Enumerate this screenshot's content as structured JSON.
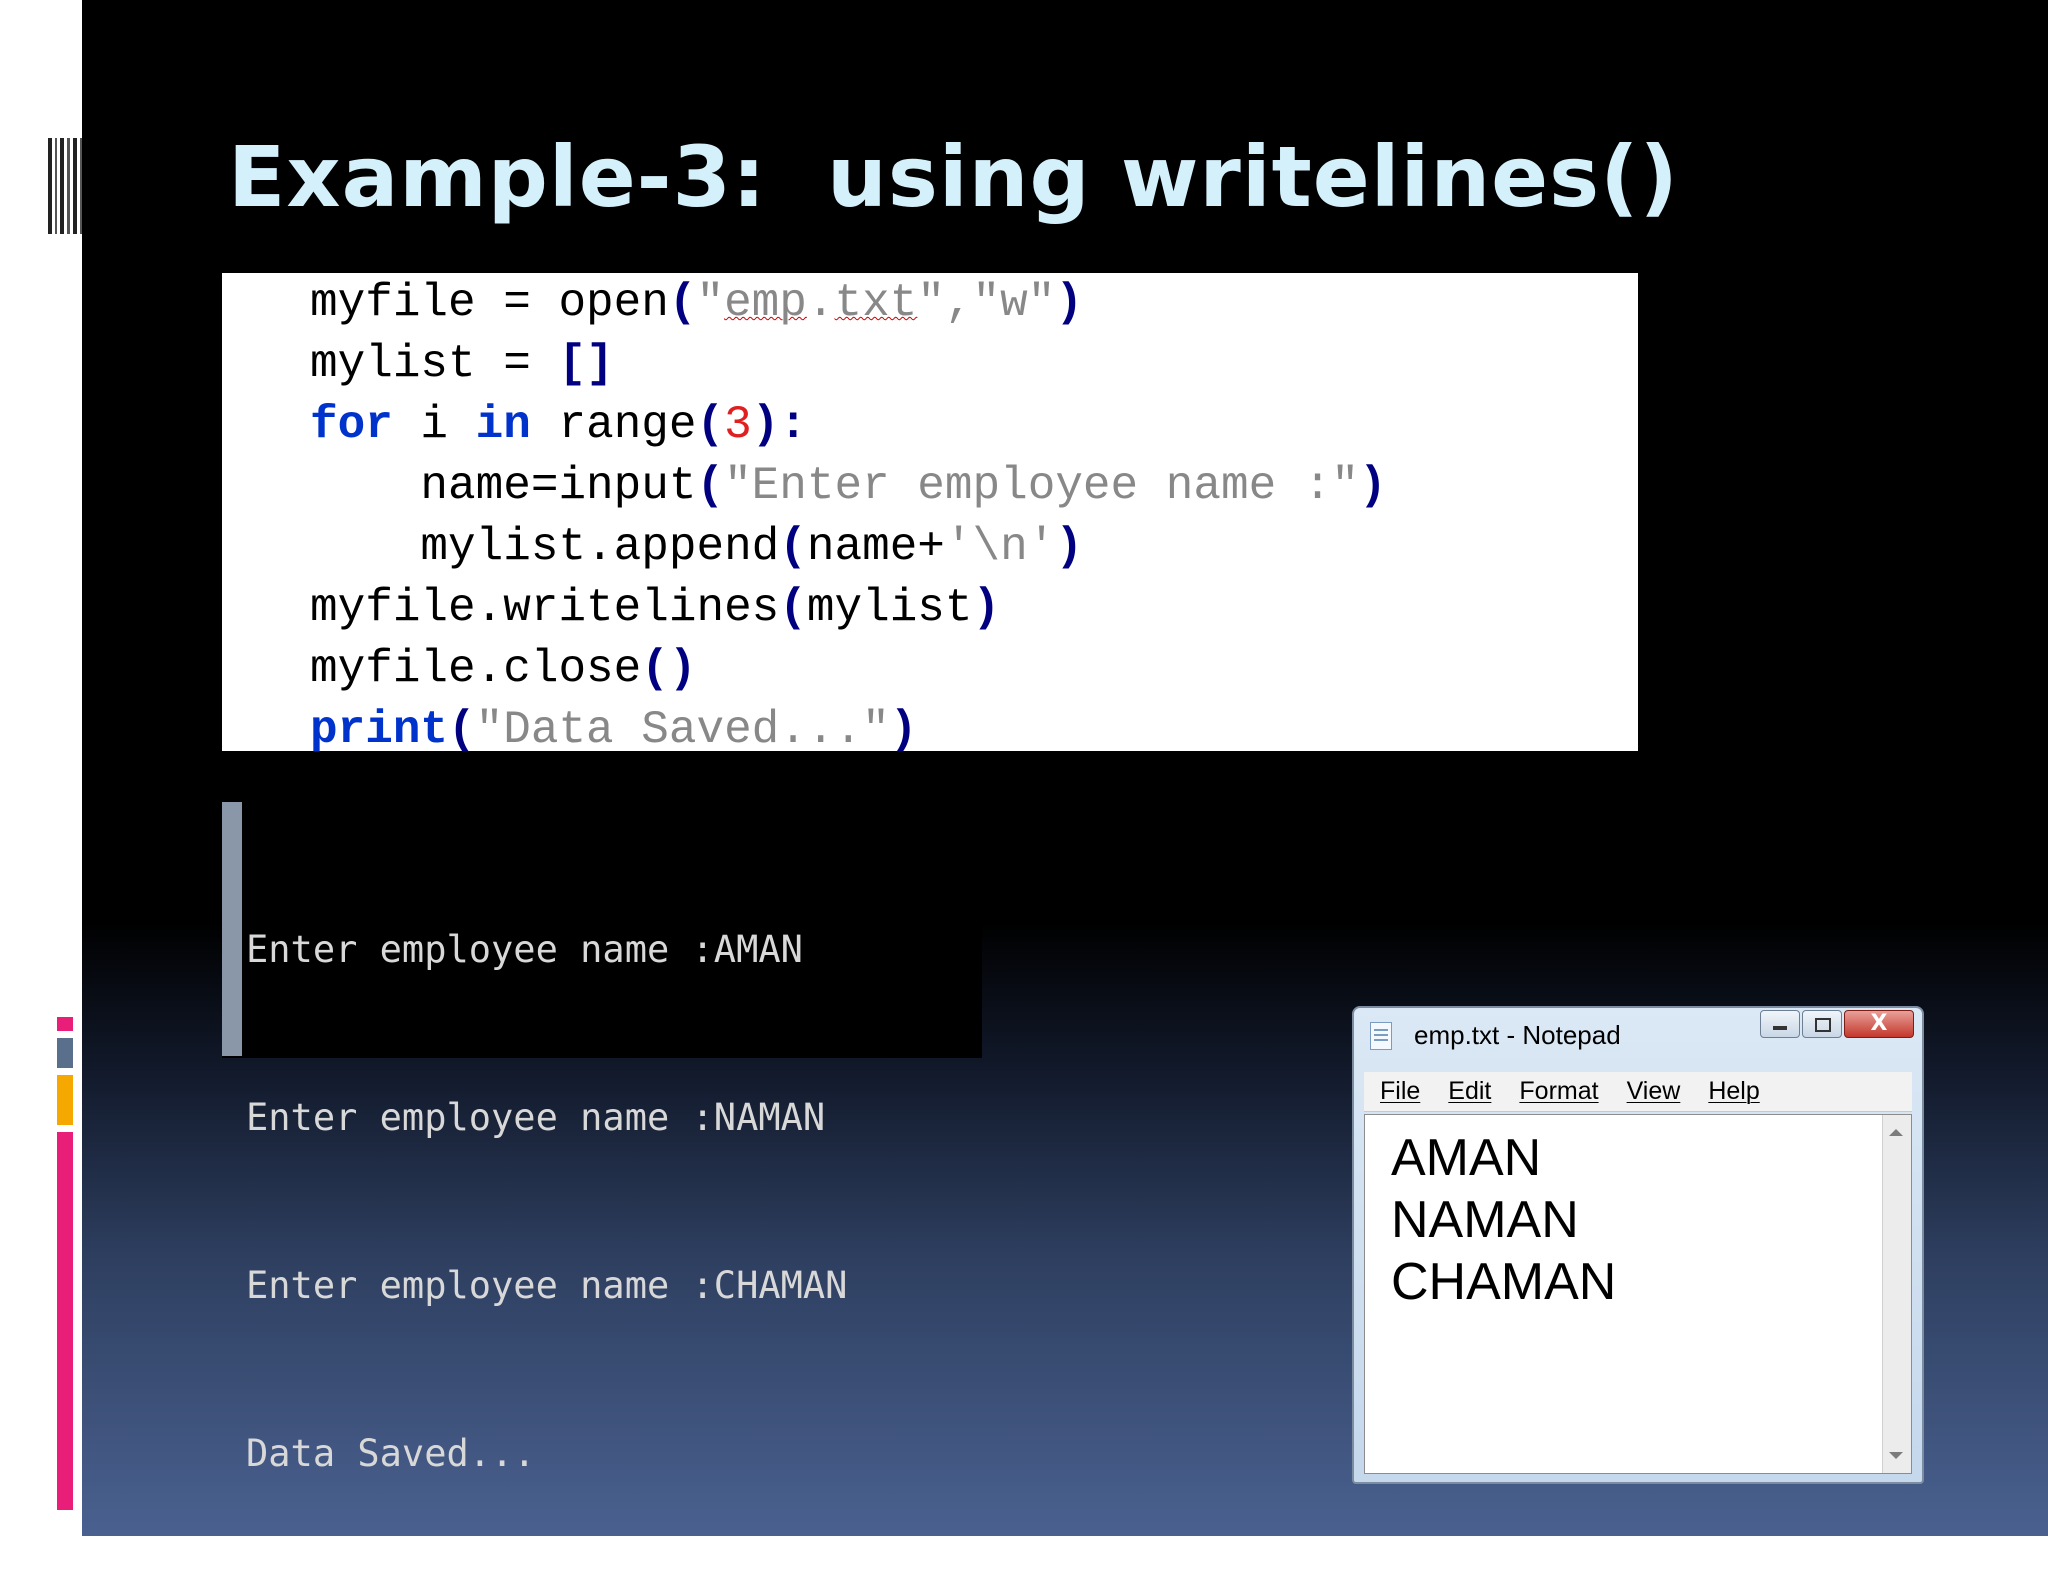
{
  "slide": {
    "title": "Example-3:  using writelines()"
  },
  "code": {
    "lines": [
      [
        {
          "t": "myfile = open",
          "c": ""
        },
        {
          "t": "(",
          "c": "par"
        },
        {
          "t": "\"",
          "c": "str"
        },
        {
          "t": "emp",
          "c": "str squig"
        },
        {
          "t": ".",
          "c": "str"
        },
        {
          "t": "txt",
          "c": "str squig"
        },
        {
          "t": "\",\"w\"",
          "c": "str"
        },
        {
          "t": ")",
          "c": "par"
        }
      ],
      [
        {
          "t": "mylist = ",
          "c": ""
        },
        {
          "t": "[]",
          "c": "par"
        }
      ],
      [
        {
          "t": "for",
          "c": "kw"
        },
        {
          "t": " i ",
          "c": ""
        },
        {
          "t": "in",
          "c": "kw"
        },
        {
          "t": " range",
          "c": ""
        },
        {
          "t": "(",
          "c": "par"
        },
        {
          "t": "3",
          "c": "num"
        },
        {
          "t": "):",
          "c": "par"
        }
      ],
      [
        {
          "t": "    name=input",
          "c": ""
        },
        {
          "t": "(",
          "c": "par"
        },
        {
          "t": "\"Enter employee name :\"",
          "c": "str"
        },
        {
          "t": ")",
          "c": "par"
        }
      ],
      [
        {
          "t": "    mylist.append",
          "c": ""
        },
        {
          "t": "(",
          "c": "par"
        },
        {
          "t": "name+",
          "c": ""
        },
        {
          "t": "'\\n'",
          "c": "str"
        },
        {
          "t": ")",
          "c": "par"
        }
      ],
      [
        {
          "t": "myfile.writelines",
          "c": ""
        },
        {
          "t": "(",
          "c": "par"
        },
        {
          "t": "mylist",
          "c": ""
        },
        {
          "t": ")",
          "c": "par"
        }
      ],
      [
        {
          "t": "myfile.close",
          "c": ""
        },
        {
          "t": "()",
          "c": "par"
        }
      ],
      [
        {
          "t": "print",
          "c": "kw"
        },
        {
          "t": "(",
          "c": "par"
        },
        {
          "t": "\"Data Saved...\"",
          "c": "str"
        },
        {
          "t": ")",
          "c": "par"
        }
      ]
    ]
  },
  "console": {
    "lines": [
      "Enter employee name :AMAN",
      "Enter employee name :NAMAN",
      "Enter employee name :CHAMAN",
      "Data Saved..."
    ]
  },
  "notepad": {
    "title": "emp.txt - Notepad",
    "close_label": "X",
    "menu": [
      "File",
      "Edit",
      "Format",
      "View",
      "Help"
    ],
    "content": [
      "AMAN",
      "NAMAN",
      "CHAMAN"
    ]
  },
  "colors": {
    "title": "#d4f0fb",
    "keyword": "#0033cc",
    "string": "#888888",
    "number": "#e02020",
    "accent_pink": "#e91e78",
    "accent_orange": "#f5a800"
  },
  "icons": [
    "notepad-icon",
    "minimize-icon",
    "maximize-icon",
    "close-icon",
    "scroll-up-icon",
    "scroll-down-icon"
  ]
}
